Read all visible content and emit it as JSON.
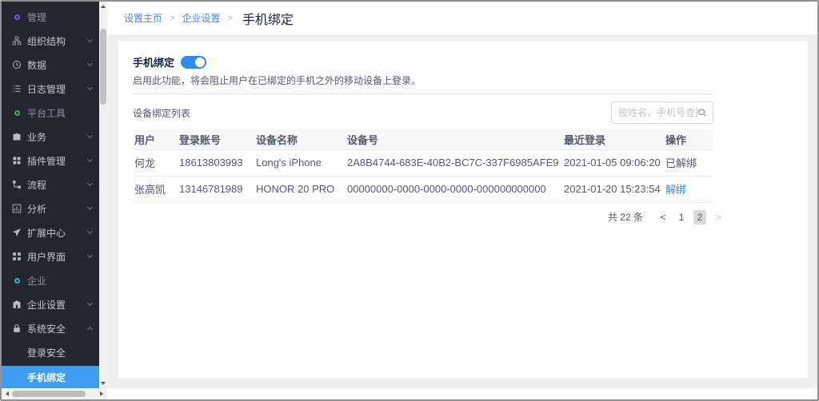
{
  "sidebar": {
    "items": [
      {
        "label": "管理",
        "type": "section",
        "icon": "circle",
        "ring_color": "#7a52f4"
      },
      {
        "label": "组织结构",
        "type": "item",
        "icon": "sitemap",
        "chevron": "down"
      },
      {
        "label": "数据",
        "type": "item",
        "icon": "clock",
        "chevron": "down"
      },
      {
        "label": "日志管理",
        "type": "item",
        "icon": "list",
        "chevron": "down"
      },
      {
        "label": "平台工具",
        "type": "section",
        "icon": "circle",
        "ring_color": "#3faf4e"
      },
      {
        "label": "业务",
        "type": "item",
        "icon": "briefcase",
        "chevron": "down"
      },
      {
        "label": "插件管理",
        "type": "item",
        "icon": "grid",
        "chevron": "down"
      },
      {
        "label": "流程",
        "type": "item",
        "icon": "flow",
        "chevron": "down"
      },
      {
        "label": "分析",
        "type": "item",
        "icon": "chart",
        "chevron": "down"
      },
      {
        "label": "扩展中心",
        "type": "item",
        "icon": "send",
        "chevron": "down"
      },
      {
        "label": "用户界面",
        "type": "item",
        "icon": "layout-grid",
        "chevron": "down"
      },
      {
        "label": "企业",
        "type": "section",
        "icon": "circle",
        "ring_color": "#2bb8c9"
      },
      {
        "label": "企业设置",
        "type": "item",
        "icon": "building",
        "chevron": "down"
      },
      {
        "label": "系统安全",
        "type": "item",
        "icon": "lock",
        "chevron": "up"
      },
      {
        "label": "登录安全",
        "type": "subitem"
      },
      {
        "label": "手机绑定",
        "type": "subitem",
        "selected": true
      }
    ]
  },
  "breadcrumb": {
    "link1": "设置主页",
    "link2": "企业设置",
    "separator": ">",
    "current": "手机绑定"
  },
  "toggle_section": {
    "label": "手机绑定",
    "enabled": true,
    "description": "启用此功能，将会阻止用户在已绑定的手机之外的移动设备上登录。"
  },
  "device_list": {
    "title": "设备绑定列表",
    "search_placeholder": "按姓名、手机号查找用户",
    "columns": [
      "用户",
      "登录账号",
      "设备名称",
      "设备号",
      "最近登录",
      "操作"
    ],
    "rows": [
      {
        "user": "何龙",
        "account": "18613803993",
        "device_name": "Long's iPhone",
        "device_id": "2A8B4744-683E-40B2-BC7C-337F6985AFE9",
        "last_login": "2021-01-05 09:06:20",
        "action": "已解绑",
        "action_type": "text"
      },
      {
        "user": "张高凯",
        "account": "13146781989",
        "device_name": "HONOR 20 PRO",
        "device_id": "00000000-0000-0000-0000-000000000000",
        "last_login": "2021-01-20 15:23:54",
        "action": "解绑",
        "action_type": "link"
      }
    ],
    "pagination": {
      "total_text": "共 22 条",
      "prev": "<",
      "page1": "1",
      "page2": "2",
      "current_page": "2",
      "next": ">"
    }
  },
  "colors": {
    "sidebar_bg": "#23262f",
    "sidebar_selected_bg": "#3d9df3",
    "accent_blue": "#2d8cf0",
    "breadcrumb_link_blue": "#4f86d8",
    "ring_management": "#7a52f4",
    "ring_platform_tools": "#3faf4e",
    "ring_enterprise": "#2bb8c9"
  }
}
